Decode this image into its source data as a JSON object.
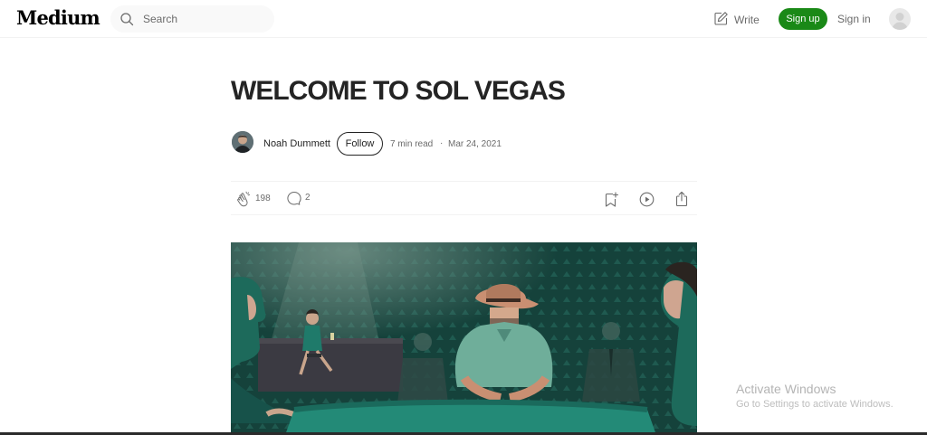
{
  "nav": {
    "logo": "Medium",
    "search_placeholder": "Search",
    "write_label": "Write",
    "signup_label": "Sign up",
    "signin_label": "Sign in"
  },
  "article": {
    "title": "WELCOME TO SOL VEGAS",
    "author": "Noah Dummett",
    "follow_label": "Follow",
    "read_time": "7 min read",
    "separator": "·",
    "date": "Mar 24, 2021",
    "claps": "198",
    "responses": "2"
  },
  "watermark": {
    "line1": "Activate Windows",
    "line2": "Go to Settings to activate Windows."
  },
  "colors": {
    "brand_green": "#1a8917",
    "text": "#242424",
    "muted": "#6b6b6b",
    "hero_teal": "#16463f"
  }
}
